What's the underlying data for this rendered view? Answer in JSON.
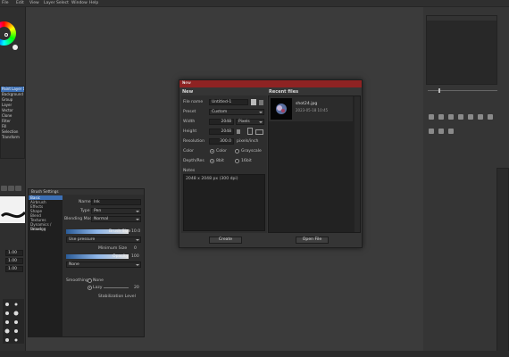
{
  "menubar": {
    "items": [
      "File",
      "Edit",
      "View",
      "Layer",
      "Select",
      "Window",
      "Help"
    ]
  },
  "left_panel": {
    "layer_items": [
      "Paint Layer 1",
      "Background",
      "Group",
      "Layer",
      "Vector",
      "Clone",
      "Filter",
      "Fill",
      "Selection",
      "Transform"
    ],
    "zoom_values": [
      "1.00",
      "1.00",
      "1.00"
    ]
  },
  "dialog": {
    "title": "New",
    "close": "×",
    "section_new": "New",
    "section_recent": "Recent files",
    "labels": {
      "file_name": "File name",
      "preset": "Preset",
      "width": "Width",
      "height": "Height",
      "resolution": "Resolution",
      "color": "Color",
      "depth": "Depth/Res",
      "notes": "Notes"
    },
    "values": {
      "file_name": "Untitled-1",
      "preset": "Custom",
      "width": "2048",
      "width_unit": "Pixels",
      "height": "2048",
      "resolution": "300.0",
      "res_unit": "pixels/inch",
      "color_opt1": "Color",
      "color_opt2": "Grayscale",
      "depth_opt1": "8bit",
      "depth_opt2": "16bit",
      "notes": "2048 x 2048 px (300 dpi)"
    },
    "recent": [
      {
        "name": "shot24.jpg",
        "date": "2023-05-18 10:45"
      }
    ],
    "buttons": {
      "create": "Create",
      "open": "Open File"
    }
  },
  "brush_panel": {
    "header": "Brush Settings",
    "categories": [
      "Basic",
      "Airbrush",
      "Effects",
      "Shape",
      "Blend",
      "Textures",
      "Dynamics / Drawing",
      "Smudge"
    ],
    "labels": {
      "name": "Name",
      "type": "Type",
      "blending": "Blending Mode",
      "brush_size": "Brush Size",
      "pressure": "Use pressure",
      "minimum_size": "Minimum Size",
      "opacity": "Opacity",
      "none": "None",
      "smoothing": "Smoothing",
      "none2": "None",
      "lazy": "Lazy",
      "stabilization": "Stabilization Level"
    },
    "values": {
      "name": "Ink",
      "type": "Pen",
      "blending": "Normal",
      "brush_size": "10.0",
      "min_size": "0",
      "opacity": "100",
      "lazy_val": "20"
    }
  },
  "colors": {
    "title_bar": "#8e2323",
    "selection": "#3c6fb4",
    "bg": "#3b3b3b"
  }
}
